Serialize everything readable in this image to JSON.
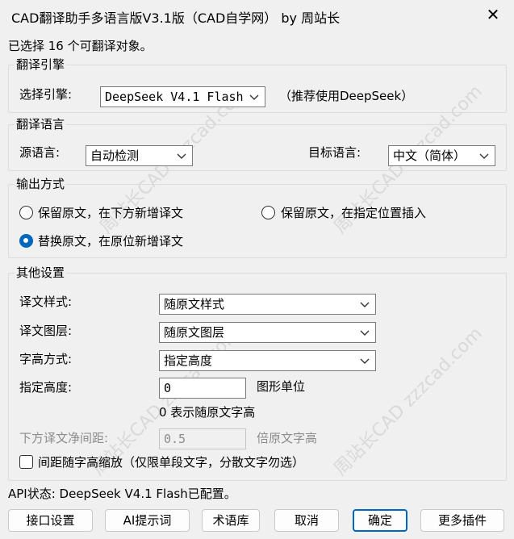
{
  "window": {
    "title": "CAD翻译助手多语言版V3.1版（CAD自学网） by 周站长",
    "close_glyph": "✕"
  },
  "selection_info": "已选择 16 个可翻译对象。",
  "engine_group": {
    "legend": "翻译引擎",
    "engine_label": "选择引擎:",
    "engine_value": "DeepSeek V4.1 Flash",
    "recommend": "（推荐使用DeepSeek）"
  },
  "language_group": {
    "legend": "翻译语言",
    "source_label": "源语言:",
    "source_value": "自动检测",
    "target_label": "目标语言:",
    "target_value": "中文（简体）"
  },
  "output_group": {
    "legend": "输出方式",
    "opt1": "保留原文，在下方新增译文",
    "opt2": "保留原文，在指定位置插入",
    "opt3": "替换原文，在原位新增译文"
  },
  "other_group": {
    "legend": "其他设置",
    "style_label": "译文样式:",
    "style_value": "随原文样式",
    "layer_label": "译文图层:",
    "layer_value": "随原文图层",
    "height_mode_label": "字高方式:",
    "height_mode_value": "指定高度",
    "height_label": "指定高度:",
    "height_value": "0",
    "height_unit": "图形单位",
    "height_hint": "0 表示随原文字高",
    "spacing_label": "下方译文净间距:",
    "spacing_value": "0.5",
    "spacing_unit": "倍原文字高",
    "scale_checkbox": "间距随字高缩放（仅限单段文字，分散文字勿选）"
  },
  "api_status": "API状态: DeepSeek V4.1 Flash已配置。",
  "buttons": {
    "interface": "接口设置",
    "ai_prompt": "AI提示词",
    "glossary": "术语库",
    "cancel": "取消",
    "ok": "确定",
    "more_plugins": "更多插件"
  },
  "watermark": "周站长CAD zzzcad.com",
  "icons": {
    "close": "close-icon",
    "chevron": "chevron-down-icon"
  }
}
